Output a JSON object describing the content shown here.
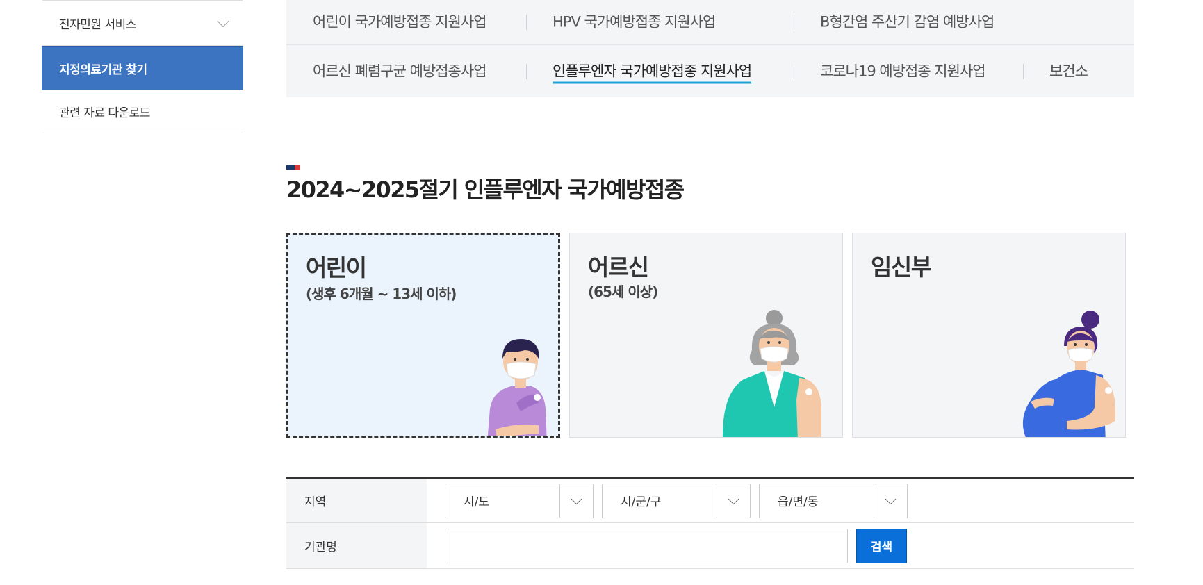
{
  "sidebar": {
    "items": [
      {
        "label": "전자민원 서비스",
        "has_chevron": true
      },
      {
        "label": "지정의료기관 찾기",
        "active": true
      },
      {
        "label": "관련 자료 다운로드"
      }
    ]
  },
  "tabs": {
    "row1": [
      "어린이 국가예방접종 지원사업",
      "HPV 국가예방접종 지원사업",
      "B형간염 주산기 감염 예방사업"
    ],
    "row2": [
      "어르신 폐렴구균 예방접종사업",
      "인플루엔자 국가예방접종 지원사업",
      "코로나19 예방접종 지원사업",
      "보건소"
    ],
    "current": "인플루엔자 국가예방접종 지원사업"
  },
  "page": {
    "title": "2024~2025절기 인플루엔자 국가예방접종",
    "accent_colors": [
      "#1a3a6b",
      "#d63a3a"
    ]
  },
  "cards": [
    {
      "title": "어린이",
      "subtitle": "(생후 6개월 ~ 13세 이하)",
      "selected": true
    },
    {
      "title": "어르신",
      "subtitle": "(65세 이상)"
    },
    {
      "title": "임신부",
      "subtitle": ""
    }
  ],
  "search": {
    "region_label": "지역",
    "selects": [
      "시/도",
      "시/군/구",
      "읍/면/동"
    ],
    "org_label": "기관명",
    "org_placeholder": "",
    "button_label": "검색"
  },
  "colors": {
    "sidebar_active": "#3d74c1",
    "tab_underline": "#1ea3d8",
    "search_button": "#0a6fd8",
    "selected_card_bg": "#ebf4fd"
  }
}
